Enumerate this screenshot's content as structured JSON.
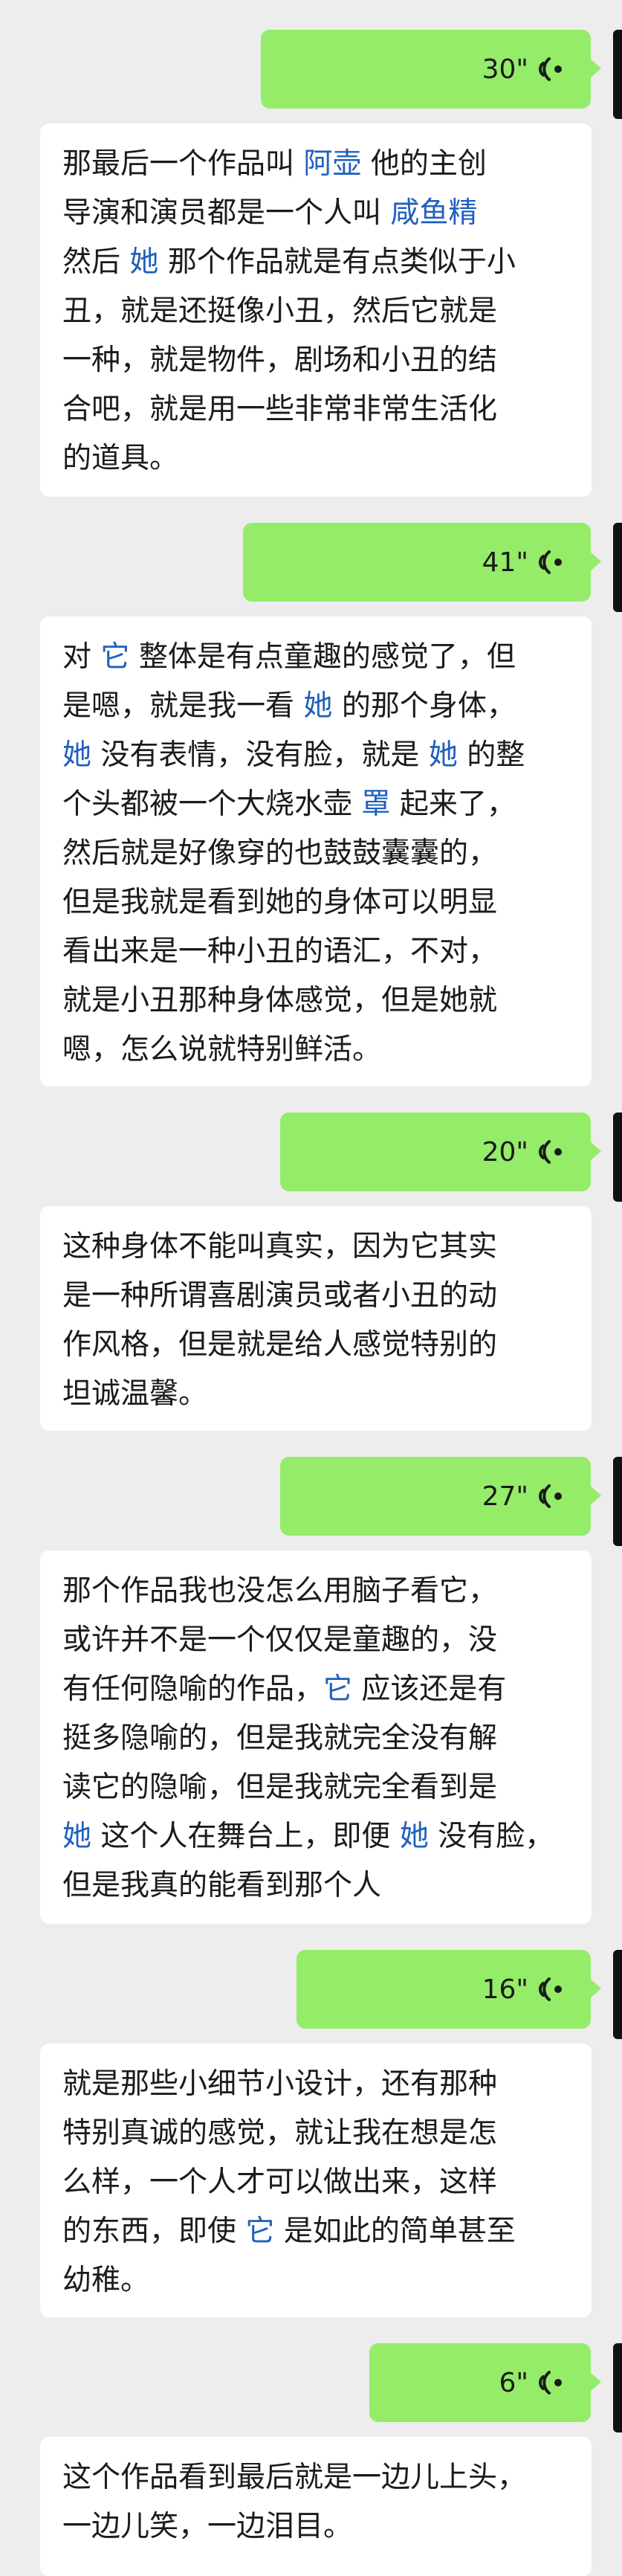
{
  "colors": {
    "voice_bubble": "#95ec69",
    "text_bubble": "#ffffff",
    "background": "#ededed",
    "keyword": "#1f5fbf"
  },
  "icons": {
    "voice_wave": "voice-wave-icon"
  },
  "messages": [
    {
      "duration": "30\"",
      "lines": [
        [
          {
            "t": "那最后一个作品叫 "
          },
          {
            "t": "阿壶",
            "kw": true
          },
          {
            "t": " 他的主创"
          }
        ],
        [
          {
            "t": "导演和演员都是一个人叫 "
          },
          {
            "t": "咸鱼精",
            "kw": true
          }
        ],
        [
          {
            "t": "然后 "
          },
          {
            "t": "她",
            "kw": true
          },
          {
            "t": " 那个作品就是有点类似于小"
          }
        ],
        [
          {
            "t": "丑，就是还挺像小丑，然后它就是"
          }
        ],
        [
          {
            "t": "一种，就是物件，剧场和小丑的结"
          }
        ],
        [
          {
            "t": "合吧，就是用一些非常非常生活化"
          }
        ],
        [
          {
            "t": "的道具。"
          }
        ]
      ]
    },
    {
      "duration": "41\"",
      "lines": [
        [
          {
            "t": "对 "
          },
          {
            "t": "它",
            "kw": true
          },
          {
            "t": " 整体是有点童趣的感觉了，但"
          }
        ],
        [
          {
            "t": "是嗯，就是我一看 "
          },
          {
            "t": "她",
            "kw": true
          },
          {
            "t": " 的那个身体，"
          }
        ],
        [
          {
            "t": "她",
            "kw": true
          },
          {
            "t": " 没有表情，没有脸，就是 "
          },
          {
            "t": "她",
            "kw": true
          },
          {
            "t": " 的整"
          }
        ],
        [
          {
            "t": "个头都被一个大烧水壶 "
          },
          {
            "t": "罩",
            "kw": true
          },
          {
            "t": " 起来了，"
          }
        ],
        [
          {
            "t": "然后就是好像穿的也鼓鼓囊囊的，"
          }
        ],
        [
          {
            "t": "但是我就是看到她的身体可以明显"
          }
        ],
        [
          {
            "t": "看出来是一种小丑的语汇，不对，"
          }
        ],
        [
          {
            "t": "就是小丑那种身体感觉，但是她就"
          }
        ],
        [
          {
            "t": "嗯，怎么说就特别鲜活。"
          }
        ]
      ]
    },
    {
      "duration": "20\"",
      "lines": [
        [
          {
            "t": "这种身体不能叫真实，因为它其实"
          }
        ],
        [
          {
            "t": "是一种所谓喜剧演员或者小丑的动"
          }
        ],
        [
          {
            "t": "作风格，但是就是给人感觉特别的"
          }
        ],
        [
          {
            "t": "坦诚温馨。"
          }
        ]
      ]
    },
    {
      "duration": "27\"",
      "lines": [
        [
          {
            "t": "那个作品我也没怎么用脑子看它，"
          }
        ],
        [
          {
            "t": "或许并不是一个仅仅是童趣的，没"
          }
        ],
        [
          {
            "t": "有任何隐喻的作品，"
          },
          {
            "t": "它",
            "kw": true
          },
          {
            "t": " 应该还是有"
          }
        ],
        [
          {
            "t": "挺多隐喻的，但是我就完全没有解"
          }
        ],
        [
          {
            "t": "读它的隐喻，但是我就完全看到是"
          }
        ],
        [
          {
            "t": "她",
            "kw": true
          },
          {
            "t": " 这个人在舞台上，即便 "
          },
          {
            "t": "她",
            "kw": true
          },
          {
            "t": " 没有脸，"
          }
        ],
        [
          {
            "t": "但是我真的能看到那个人"
          }
        ]
      ]
    },
    {
      "duration": "16\"",
      "lines": [
        [
          {
            "t": "就是那些小细节小设计，还有那种"
          }
        ],
        [
          {
            "t": "特别真诚的感觉，就让我在想是怎"
          }
        ],
        [
          {
            "t": "么样，一个人才可以做出来，这样"
          }
        ],
        [
          {
            "t": "的东西，即使 "
          },
          {
            "t": "它",
            "kw": true
          },
          {
            "t": " 是如此的简单甚至"
          }
        ],
        [
          {
            "t": "幼稚。"
          }
        ]
      ]
    },
    {
      "duration": "6\"",
      "lines": [
        [
          {
            "t": "这个作品看到最后就是一边儿上头，"
          }
        ],
        [
          {
            "t": "一边儿笑，一边泪目。"
          }
        ]
      ]
    }
  ]
}
